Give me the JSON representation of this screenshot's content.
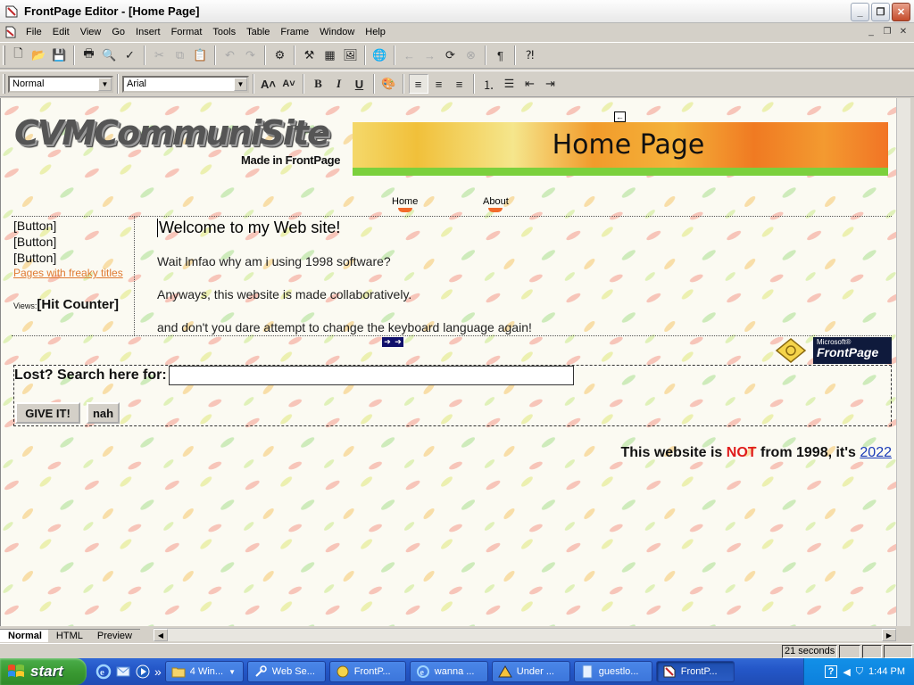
{
  "window": {
    "title": "FrontPage Editor - [Home Page]"
  },
  "menu": [
    "File",
    "Edit",
    "View",
    "Go",
    "Insert",
    "Format",
    "Tools",
    "Table",
    "Frame",
    "Window",
    "Help"
  ],
  "format_toolbar": {
    "style": "Normal",
    "font": "Arial"
  },
  "page": {
    "logo_main": "CVMCommuniSite",
    "logo_sub": "Made in FrontPage",
    "banner_title": "Home Page",
    "nav": [
      "Home",
      "About"
    ],
    "left_buttons": [
      "[Button]",
      "[Button]",
      "[Button]"
    ],
    "freaky_link": "Pages with freaky titles",
    "views_label": "Views:",
    "hit_counter": "[Hit Counter]",
    "welcome": "Welcome to my Web site!",
    "paragraphs": [
      "Wait lmfao why am i using 1998 software?",
      "Anyways, this website is made collaboratively.",
      "and don't you dare attempt to change the keyboard language again!"
    ],
    "fp_badge_small": "Microsoft®",
    "fp_badge": "FrontPage",
    "search_label": "Lost? Search here for:",
    "search_value": "",
    "submit_label": "GIVE IT!",
    "reset_label": "nah",
    "footer_prefix": "This website is ",
    "footer_not": "NOT",
    "footer_mid": " from 1998, it's ",
    "footer_year": "2022"
  },
  "tabs": [
    "Normal",
    "HTML",
    "Preview"
  ],
  "status": {
    "download_time": "21 seconds"
  },
  "taskbar": {
    "start": "start",
    "tasks": [
      {
        "label": "4 Win...",
        "icon": "folder-icon"
      },
      {
        "label": "Web Se...",
        "icon": "tools-icon"
      },
      {
        "label": "FrontP...",
        "icon": "frontpage-icon"
      },
      {
        "label": "wanna ...",
        "icon": "ie-icon"
      },
      {
        "label": "Under ...",
        "icon": "construction-icon"
      },
      {
        "label": "guestlo...",
        "icon": "document-icon"
      },
      {
        "label": "FrontP...",
        "icon": "frontpage-editor-icon"
      }
    ],
    "clock": "1:44 PM"
  },
  "colors": {
    "accent_not": "#e01c1c",
    "link": "#1a3bb8",
    "freaky_link": "#e07a32"
  }
}
